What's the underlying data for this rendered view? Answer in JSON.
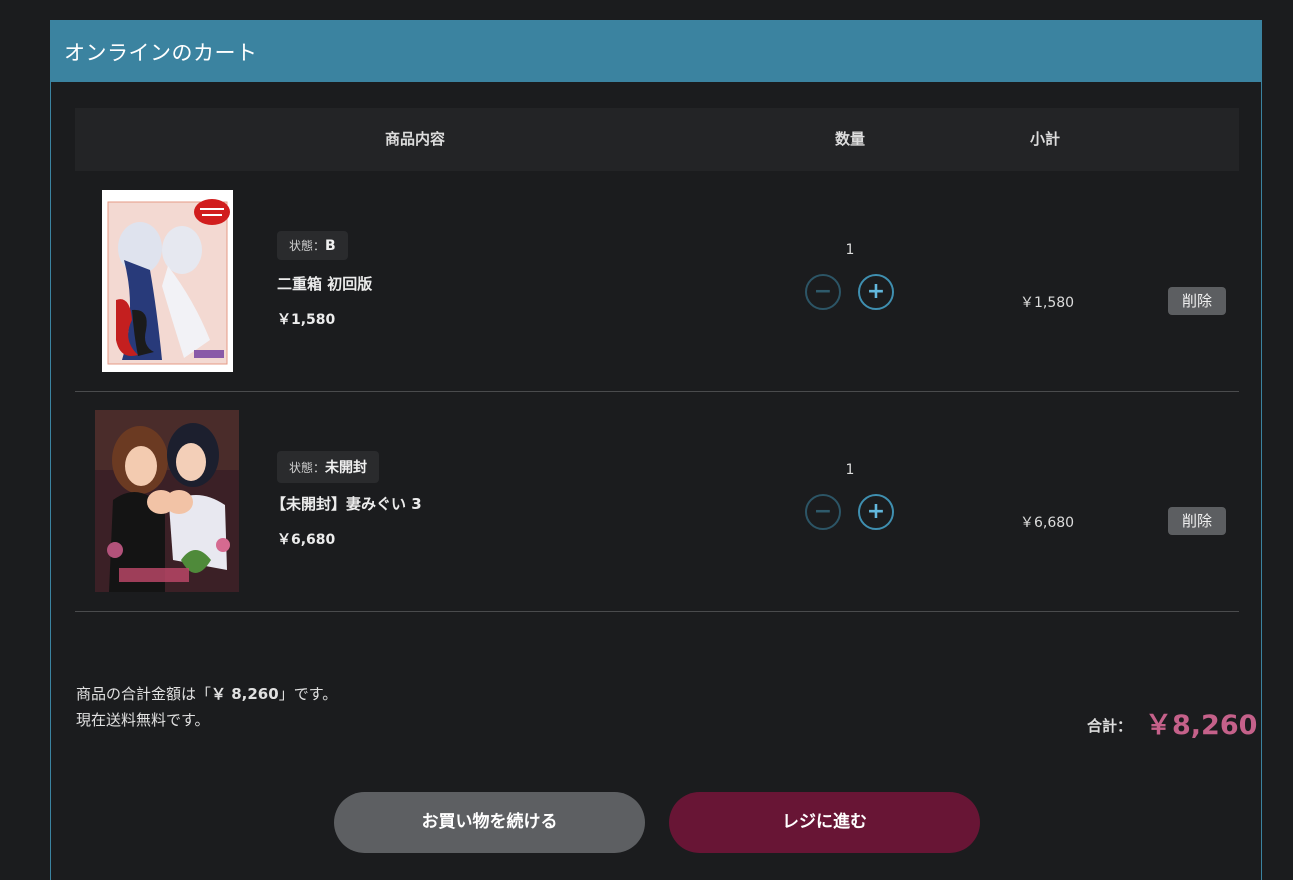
{
  "panel": {
    "title": "オンラインのカート"
  },
  "table": {
    "headers": {
      "item": "商品内容",
      "qty": "数量",
      "subtotal": "小計"
    }
  },
  "items": [
    {
      "condition_label": "状態：",
      "condition_value": "B",
      "name": "二重箱 初回版",
      "price": "￥1,580",
      "qty": "1",
      "subtotal": "￥1,580",
      "delete_label": "削除"
    },
    {
      "condition_label": "状態：",
      "condition_value": "未開封",
      "name": "【未開封】妻みぐい 3",
      "price": "￥6,680",
      "qty": "1",
      "subtotal": "￥6,680",
      "delete_label": "削除"
    }
  ],
  "summary": {
    "line1_pre": "商品の合計金額は「",
    "line1_amount": "￥ 8,260",
    "line1_post": "」です。",
    "line2": "現在送料無料です。",
    "total_label": "合計：",
    "total_value": "￥8,260"
  },
  "actions": {
    "continue_label": "お買い物を続ける",
    "checkout_label": "レジに進む"
  },
  "colors": {
    "header_bg": "#3b83a0",
    "total": "#c5618a",
    "checkout": "#681535",
    "continue": "#5d5f62"
  },
  "icons": {
    "minus": "minus-circle-icon",
    "plus": "plus-circle-icon"
  }
}
